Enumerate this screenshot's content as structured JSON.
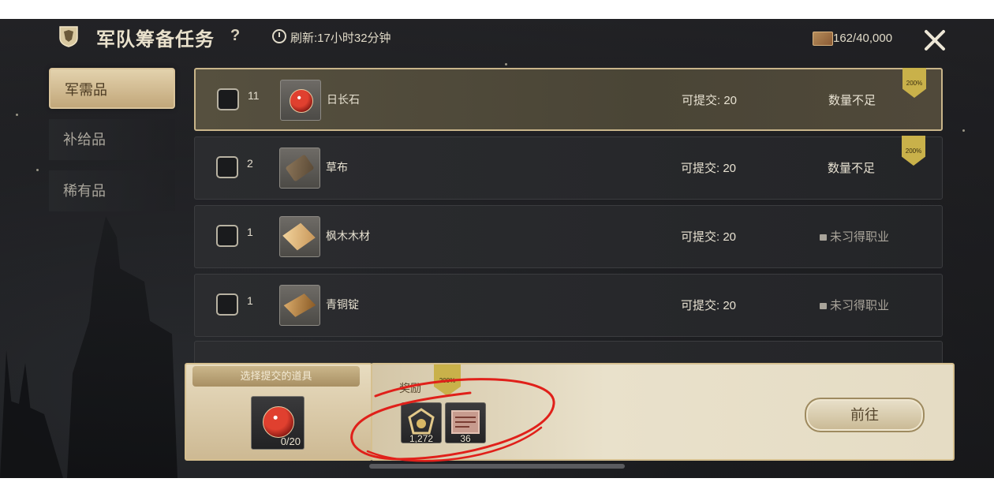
{
  "header": {
    "title": "军队筹备任务",
    "help_label": "?",
    "refresh_text": "刷新:17小时32分钟",
    "currency_value": "162/40,000",
    "icons": [
      "emblem-icon",
      "clock-icon",
      "currency-icon",
      "close-icon"
    ]
  },
  "tabs": [
    {
      "label": "军需品",
      "active": true
    },
    {
      "label": "补给品",
      "active": false
    },
    {
      "label": "稀有品",
      "active": false
    }
  ],
  "tasks": [
    {
      "job_level": "11",
      "job_icon": "jewelry-icon",
      "item_icon": "gem-icon",
      "item_name": "日长石",
      "submit_label": "可提交: 20",
      "status": "数量不足",
      "badge": "200%",
      "selected": true
    },
    {
      "job_level": "2",
      "job_icon": "weaving-icon",
      "item_icon": "cloth-icon",
      "item_name": "草布",
      "submit_label": "可提交: 20",
      "status": "数量不足",
      "badge": "200%",
      "selected": false
    },
    {
      "job_level": "1",
      "job_icon": "woodworking-icon",
      "item_icon": "lumber-icon",
      "item_name": "枫木木材",
      "submit_label": "可提交: 20",
      "status": "未习得职业",
      "locked": true,
      "selected": false
    },
    {
      "job_level": "1",
      "job_icon": "smithing-icon",
      "item_icon": "ingot-icon",
      "item_name": "青铜锭",
      "submit_label": "可提交: 20",
      "status": "未习得职业",
      "locked": true,
      "selected": false
    }
  ],
  "submit_panel": {
    "title": "选择提交的道具",
    "count": "0/20"
  },
  "reward_panel": {
    "label": "奖励",
    "badge": "200%",
    "rewards": [
      {
        "icon": "medal-icon",
        "qty": "1,272"
      },
      {
        "icon": "scroll-icon",
        "qty": "36"
      }
    ],
    "go_label": "前往"
  },
  "colors": {
    "accent_gold": "#c9b14a",
    "annotation_red": "#e0201a",
    "panel_cream": "#e9e1cb"
  }
}
